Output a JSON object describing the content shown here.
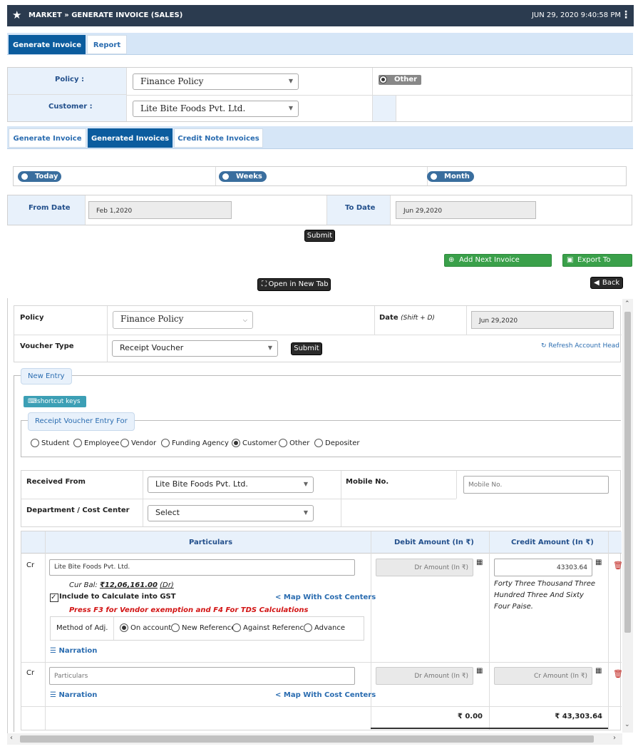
{
  "header": {
    "title": "MARKET » GENERATE INVOICE (SALES)",
    "datetime": "JUN 29, 2020  9:40:58 PM"
  },
  "top_tabs": [
    "Generate Invoice",
    "Report"
  ],
  "policy_form": {
    "policy_label": "Policy :",
    "policy_value": "Finance Policy",
    "other_label": "Other",
    "customer_label": "Customer :",
    "customer_value": "Lite Bite Foods Pvt. Ltd."
  },
  "sub_tabs": [
    "Generate Invoice",
    "Generated Invoices",
    "Credit Note Invoices"
  ],
  "range": {
    "options": [
      "Today",
      "Weeks",
      "Month"
    ],
    "from_label": "From Date",
    "from_value": "Feb 1,2020",
    "to_label": "To Date",
    "to_value": "Jun 29,2020",
    "submit": "Submit"
  },
  "actions": {
    "reminder": "Add Next Invoice Reminder",
    "export": "Export To Excel",
    "open_tab": "Open in New Tab",
    "back": "Back"
  },
  "voucher": {
    "policy_label": "Policy",
    "policy_value": "Finance Policy",
    "date_label": "Date",
    "date_hint": "(Shift + D)",
    "date_value": "Jun 29,2020",
    "type_label": "Voucher Type",
    "type_value": "Receipt Voucher",
    "submit": "Submit",
    "refresh": "Refresh Account Head"
  },
  "entry": {
    "legend": "New Entry",
    "shortcut": "shortcut keys",
    "for_legend": "Receipt Voucher Entry For",
    "for_options": [
      "Student",
      "Employee",
      "Vendor",
      "Funding Agency",
      "Customer",
      "Other",
      "Depositer"
    ],
    "for_selected": "Customer"
  },
  "received": {
    "label": "Received From",
    "value": "Lite Bite Foods Pvt. Ltd.",
    "mobile_label": "Mobile No.",
    "mobile_placeholder": "Mobile No.",
    "dept_label": "Department / Cost Center",
    "dept_value": "Select"
  },
  "table": {
    "headers": [
      "Particulars",
      "Debit Amount (In ₹)",
      "Credit Amount (In ₹)"
    ],
    "row1": {
      "type": "Cr",
      "particular": "Lite Bite Foods Pvt. Ltd.",
      "curbal_label": "Cur Bal:",
      "curbal_value": "₹12,06,161.00",
      "curbal_dr": "(Dr)",
      "gst": "Include to Calculate into GST",
      "map": "Map With Cost Centers",
      "warning": "Press F3 for Vendor exemption and F4 For TDS Calculations",
      "method_label": "Method of Adj.",
      "methods": [
        "On account",
        "New Reference",
        "Against Reference",
        "Advance"
      ],
      "method_selected": "On account",
      "narration": "Narration",
      "dr_placeholder": "Dr Amount (In ₹)",
      "credit": "43303.64",
      "credit_words": "Forty Three Thousand Three Hundred Three And Sixty Four Paise."
    },
    "row2": {
      "type": "Cr",
      "placeholder": "Particulars",
      "narration": "Narration",
      "map": "Map With Cost Centers",
      "dr_placeholder": "Dr Amount (In ₹)",
      "cr_placeholder": "Cr Amount (In ₹)"
    },
    "totals": {
      "debit": "₹ 0.00",
      "credit": "₹ 43,303.64"
    }
  }
}
